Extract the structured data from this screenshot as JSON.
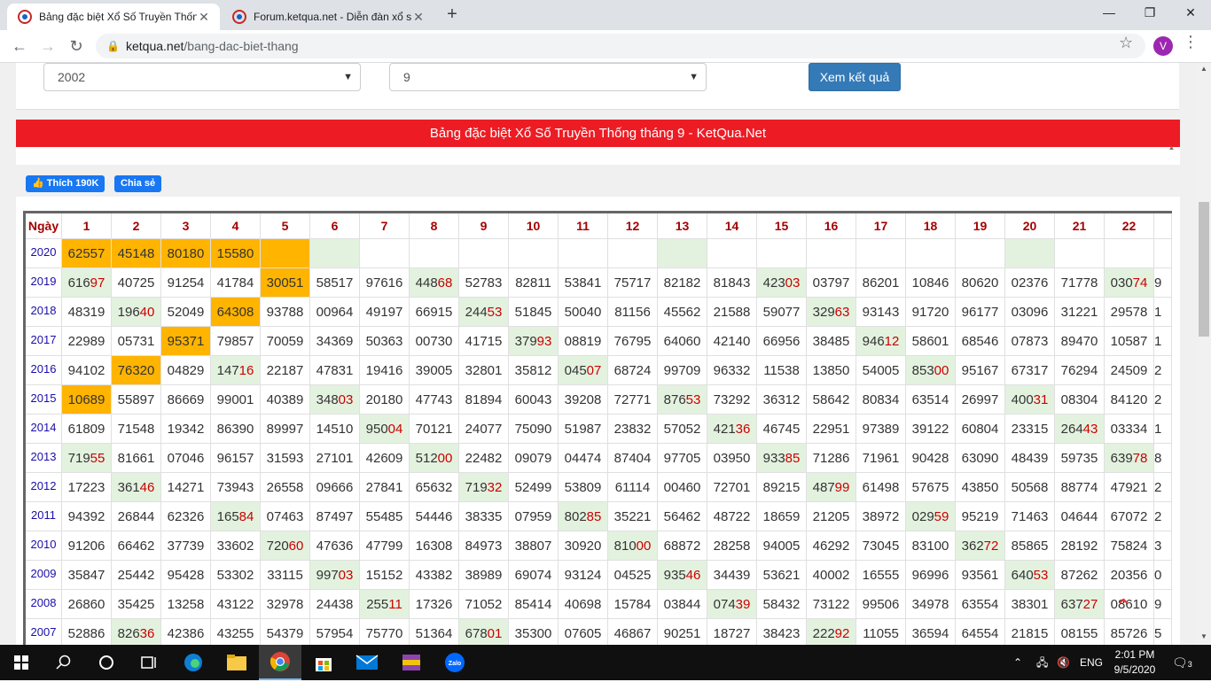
{
  "browser": {
    "tabs": [
      {
        "title": "Bảng đặc biệt Xổ Số Truyền Thống",
        "active": true
      },
      {
        "title": "Forum.ketqua.net - Diễn đàn xổ số",
        "active": false
      }
    ],
    "url_host": "ketqua.net",
    "url_path": "/bang-dac-biet-thang",
    "profile_initial": "V"
  },
  "form": {
    "year_value": "2002",
    "month_value": "9",
    "submit_label": "Xem kết quả"
  },
  "banner": "Bảng đặc biệt Xổ Số Truyền Thống tháng 9 - KetQua.Net",
  "social": {
    "like_label": "Thích 190K",
    "share_label": "Chia sẻ"
  },
  "table": {
    "header": [
      "Ngày",
      "1",
      "2",
      "3",
      "4",
      "5",
      "6",
      "7",
      "8",
      "9",
      "10",
      "11",
      "12",
      "13",
      "14",
      "15",
      "16",
      "17",
      "18",
      "19",
      "20",
      "21",
      "22"
    ],
    "rows": [
      {
        "year": "2020",
        "cells": [
          "62557",
          "45148",
          "80180",
          "15580",
          "",
          "",
          "",
          "",
          "",
          "",
          "",
          "",
          "",
          "",
          "",
          "",
          "",
          "",
          "",
          "",
          "",
          ""
        ]
      },
      {
        "year": "2019",
        "cells": [
          "61697",
          "40725",
          "91254",
          "41784",
          "30051",
          "58517",
          "97616",
          "44868",
          "52783",
          "82811",
          "53841",
          "75717",
          "82182",
          "81843",
          "42303",
          "03797",
          "86201",
          "10846",
          "80620",
          "02376",
          "71778",
          "03074"
        ]
      },
      {
        "year": "2018",
        "cells": [
          "48319",
          "19640",
          "52049",
          "64308",
          "93788",
          "00964",
          "49197",
          "66915",
          "24453",
          "51845",
          "50040",
          "81156",
          "45562",
          "21588",
          "59077",
          "32963",
          "93143",
          "91720",
          "96177",
          "03096",
          "31221",
          "29578"
        ]
      },
      {
        "year": "2017",
        "cells": [
          "22989",
          "05731",
          "95371",
          "79857",
          "70059",
          "34369",
          "50363",
          "00730",
          "41715",
          "37993",
          "08819",
          "76795",
          "64060",
          "42140",
          "66956",
          "38485",
          "94612",
          "58601",
          "68546",
          "07873",
          "89470",
          "10587"
        ]
      },
      {
        "year": "2016",
        "cells": [
          "94102",
          "76320",
          "04829",
          "14716",
          "22187",
          "47831",
          "19416",
          "39005",
          "32801",
          "35812",
          "04507",
          "68724",
          "99709",
          "96332",
          "11538",
          "13850",
          "54005",
          "85300",
          "95167",
          "67317",
          "76294",
          "24509"
        ]
      },
      {
        "year": "2015",
        "cells": [
          "10689",
          "55897",
          "86669",
          "99001",
          "40389",
          "34803",
          "20180",
          "47743",
          "81894",
          "60043",
          "39208",
          "72771",
          "87653",
          "73292",
          "36312",
          "58642",
          "80834",
          "63514",
          "26997",
          "40031",
          "08304",
          "84120"
        ]
      },
      {
        "year": "2014",
        "cells": [
          "61809",
          "71548",
          "19342",
          "86390",
          "89997",
          "14510",
          "95004",
          "70121",
          "24077",
          "75090",
          "51987",
          "23832",
          "57052",
          "42136",
          "46745",
          "22951",
          "97389",
          "39122",
          "60804",
          "23315",
          "26443",
          "03334"
        ]
      },
      {
        "year": "2013",
        "cells": [
          "71955",
          "81661",
          "07046",
          "96157",
          "31593",
          "27101",
          "42609",
          "51200",
          "22482",
          "09079",
          "04474",
          "87404",
          "97705",
          "03950",
          "93385",
          "71286",
          "71961",
          "90428",
          "63090",
          "48439",
          "59735",
          "63978"
        ]
      },
      {
        "year": "2012",
        "cells": [
          "17223",
          "36146",
          "14271",
          "73943",
          "26558",
          "09666",
          "27841",
          "65632",
          "71932",
          "52499",
          "53809",
          "61114",
          "00460",
          "72701",
          "89215",
          "48799",
          "61498",
          "57675",
          "43850",
          "50568",
          "88774",
          "47921"
        ]
      },
      {
        "year": "2011",
        "cells": [
          "94392",
          "26844",
          "62326",
          "16584",
          "07463",
          "87497",
          "55485",
          "54446",
          "38335",
          "07959",
          "80285",
          "35221",
          "56462",
          "48722",
          "18659",
          "21205",
          "38972",
          "02959",
          "95219",
          "71463",
          "04644",
          "67072"
        ]
      },
      {
        "year": "2010",
        "cells": [
          "91206",
          "66462",
          "37739",
          "33602",
          "72060",
          "47636",
          "47799",
          "16308",
          "84973",
          "38807",
          "30920",
          "81000",
          "68872",
          "28258",
          "94005",
          "46292",
          "73045",
          "83100",
          "36272",
          "85865",
          "28192",
          "75824"
        ]
      },
      {
        "year": "2009",
        "cells": [
          "35847",
          "25442",
          "95428",
          "53302",
          "33115",
          "99703",
          "15152",
          "43382",
          "38989",
          "69074",
          "93124",
          "04525",
          "93546",
          "34439",
          "53621",
          "40002",
          "16555",
          "96996",
          "93561",
          "64053",
          "87262",
          "20356"
        ]
      },
      {
        "year": "2008",
        "cells": [
          "26860",
          "35425",
          "13258",
          "43122",
          "32978",
          "24438",
          "25511",
          "17326",
          "71052",
          "85414",
          "40698",
          "15784",
          "03844",
          "07439",
          "58432",
          "73122",
          "99506",
          "34978",
          "63554",
          "38301",
          "63727",
          "08610"
        ]
      },
      {
        "year": "2007",
        "cells": [
          "52886",
          "82636",
          "42386",
          "43255",
          "54379",
          "57954",
          "75770",
          "51364",
          "67801",
          "35300",
          "07605",
          "46867",
          "90251",
          "18727",
          "38423",
          "22292",
          "11055",
          "36594",
          "64554",
          "21815",
          "08155",
          "85726"
        ]
      }
    ],
    "overflow_col": [
      "",
      "9",
      "1",
      "1",
      "2",
      "2",
      "1",
      "8",
      "2",
      "2",
      "3",
      "0",
      "9",
      "5"
    ]
  },
  "taskbar": {
    "lang": "ENG",
    "time": "2:01 PM",
    "date": "9/5/2020",
    "notif_count": "3"
  },
  "colors": {
    "highlight_orange": "#ffb400",
    "highlight_green": "#e3f2df",
    "banner_red": "#ed1c24",
    "button_blue": "#337ab7"
  }
}
